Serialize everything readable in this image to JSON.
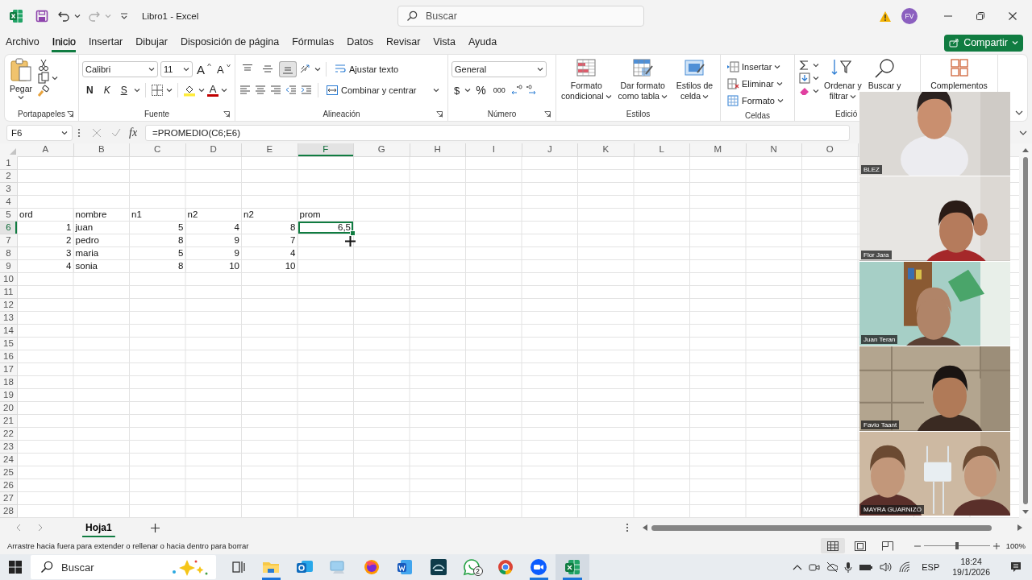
{
  "window": {
    "title": "Libro1 - Excel",
    "search_placeholder": "Buscar",
    "account_initials": "FV"
  },
  "menu_tabs": [
    {
      "label": "Archivo",
      "selected": false
    },
    {
      "label": "Inicio",
      "selected": true
    },
    {
      "label": "Insertar",
      "selected": false
    },
    {
      "label": "Dibujar",
      "selected": false
    },
    {
      "label": "Disposición de página",
      "selected": false
    },
    {
      "label": "Fórmulas",
      "selected": false
    },
    {
      "label": "Datos",
      "selected": false
    },
    {
      "label": "Revisar",
      "selected": false
    },
    {
      "label": "Vista",
      "selected": false
    },
    {
      "label": "Ayuda",
      "selected": false
    }
  ],
  "share_button": "Compartir",
  "ribbon": {
    "clipboard": {
      "paste": "Pegar",
      "label": "Portapapeles"
    },
    "font": {
      "family": "Calibri",
      "size": "11",
      "grow": "A",
      "shrink": "A",
      "bold": "N",
      "italic": "K",
      "underline": "S",
      "foreground": "A",
      "label": "Fuente"
    },
    "alignment": {
      "vertical": [
        {
          "kind": "top",
          "selected": false
        },
        {
          "kind": "middle",
          "selected": false
        },
        {
          "kind": "bottom",
          "selected": true
        }
      ],
      "wrap_text": "Ajustar texto",
      "merge": "Combinar y centrar",
      "label": "Alineación"
    },
    "number": {
      "format": "General",
      "currency": "$",
      "percent": "%",
      "thousands": "000",
      "label": "Número"
    },
    "styles": {
      "buttons": [
        {
          "kind": "conditional",
          "lines": [
            "Formato",
            "condicional"
          ]
        },
        {
          "kind": "table",
          "lines": [
            "Dar formato",
            "como tabla"
          ]
        },
        {
          "kind": "cell",
          "lines": [
            "Estilos de",
            "celda"
          ]
        }
      ],
      "label": "Estilos"
    },
    "cells": {
      "buttons": [
        {
          "kind": "insert",
          "label": "Insertar"
        },
        {
          "kind": "delete",
          "label": "Eliminar"
        },
        {
          "kind": "format",
          "label": "Formato"
        }
      ],
      "label": "Celdas"
    },
    "editing": {
      "sort": [
        "Ordenar y",
        "filtrar"
      ],
      "find": [
        "Buscar y"
      ],
      "label": "Edició"
    },
    "addins": {
      "label": "Complementos"
    }
  },
  "formula_bar": {
    "name_box": "F6",
    "function_button": "fx",
    "formula": "=PROMEDIO(C6;E6)"
  },
  "sheet": {
    "columns": [
      {
        "label": "A",
        "selected": false
      },
      {
        "label": "B",
        "selected": false
      },
      {
        "label": "C",
        "selected": false
      },
      {
        "label": "D",
        "selected": false
      },
      {
        "label": "E",
        "selected": false
      },
      {
        "label": "F",
        "selected": true
      },
      {
        "label": "G",
        "selected": false
      },
      {
        "label": "H",
        "selected": false
      },
      {
        "label": "I",
        "selected": false
      },
      {
        "label": "J",
        "selected": false
      },
      {
        "label": "K",
        "selected": false
      },
      {
        "label": "L",
        "selected": false
      },
      {
        "label": "M",
        "selected": false
      },
      {
        "label": "N",
        "selected": false
      },
      {
        "label": "O",
        "selected": false
      }
    ],
    "rows": [
      {
        "label": "1",
        "selected": false
      },
      {
        "label": "2",
        "selected": false
      },
      {
        "label": "3",
        "selected": false
      },
      {
        "label": "4",
        "selected": false
      },
      {
        "label": "5",
        "selected": false,
        "cells": [
          {
            "text": "ord",
            "kind": "text",
            "active": false
          },
          {
            "text": "nombre",
            "kind": "text",
            "active": false
          },
          {
            "text": "n1",
            "kind": "text",
            "active": false
          },
          {
            "text": "n2",
            "kind": "text",
            "active": false
          },
          {
            "text": "n2",
            "kind": "text",
            "active": false
          },
          {
            "text": "prom",
            "kind": "text",
            "active": false
          }
        ]
      },
      {
        "label": "6",
        "selected": true,
        "cells": [
          {
            "text": "1",
            "kind": "number",
            "active": false
          },
          {
            "text": "juan",
            "kind": "text",
            "active": false
          },
          {
            "text": "5",
            "kind": "number",
            "active": false
          },
          {
            "text": "4",
            "kind": "number",
            "active": false
          },
          {
            "text": "8",
            "kind": "number",
            "active": false
          },
          {
            "text": "6,5",
            "kind": "number",
            "active": true
          }
        ]
      },
      {
        "label": "7",
        "selected": false,
        "cells": [
          {
            "text": "2",
            "kind": "number",
            "active": false
          },
          {
            "text": "pedro",
            "kind": "text",
            "active": false
          },
          {
            "text": "8",
            "kind": "number",
            "active": false
          },
          {
            "text": "9",
            "kind": "number",
            "active": false
          },
          {
            "text": "7",
            "kind": "number",
            "active": false
          }
        ]
      },
      {
        "label": "8",
        "selected": false,
        "cells": [
          {
            "text": "3",
            "kind": "number",
            "active": false
          },
          {
            "text": "maria",
            "kind": "text",
            "active": false
          },
          {
            "text": "5",
            "kind": "number",
            "active": false
          },
          {
            "text": "9",
            "kind": "number",
            "active": false
          },
          {
            "text": "4",
            "kind": "number",
            "active": false
          }
        ]
      },
      {
        "label": "9",
        "selected": false,
        "cells": [
          {
            "text": "4",
            "kind": "number",
            "active": false
          },
          {
            "text": "sonia",
            "kind": "text",
            "active": false
          },
          {
            "text": "8",
            "kind": "number",
            "active": false
          },
          {
            "text": "10",
            "kind": "number",
            "active": false
          },
          {
            "text": "10",
            "kind": "number",
            "active": false
          }
        ]
      },
      {
        "label": "10",
        "selected": false
      },
      {
        "label": "11",
        "selected": false
      },
      {
        "label": "12",
        "selected": false
      },
      {
        "label": "13",
        "selected": false
      },
      {
        "label": "14",
        "selected": false
      },
      {
        "label": "15",
        "selected": false
      },
      {
        "label": "16",
        "selected": false
      },
      {
        "label": "17",
        "selected": false
      },
      {
        "label": "18",
        "selected": false
      },
      {
        "label": "19",
        "selected": false
      },
      {
        "label": "20",
        "selected": false
      },
      {
        "label": "21",
        "selected": false
      },
      {
        "label": "22",
        "selected": false
      },
      {
        "label": "23",
        "selected": false
      },
      {
        "label": "24",
        "selected": false
      },
      {
        "label": "25",
        "selected": false
      },
      {
        "label": "26",
        "selected": false
      },
      {
        "label": "27",
        "selected": false
      },
      {
        "label": "28",
        "selected": false
      }
    ]
  },
  "video_tiles": [
    {
      "kind": "picture",
      "name": "BLEZ"
    },
    {
      "kind": "picture",
      "name": "Flor Jara"
    },
    {
      "kind": "picture",
      "name": "Juan Teran"
    },
    {
      "kind": "picture",
      "name": "Favio Taant"
    },
    {
      "kind": "picture",
      "name": "MAYRA GUARNIZO"
    }
  ],
  "sheet_tabs": [
    {
      "label": "Hoja1",
      "selected": true
    }
  ],
  "status_bar": {
    "message": "Arrastre hacia fuera para extender o rellenar o hacia dentro para borrar",
    "views": [
      {
        "kind": "normal",
        "selected": true
      },
      {
        "kind": "page_layout",
        "selected": false
      },
      {
        "kind": "page_break",
        "selected": false
      }
    ],
    "zoom": {
      "level": 0.5,
      "reading": "100%"
    }
  },
  "taskbar": {
    "search_placeholder": "Buscar",
    "apps": [
      {
        "kind": "task_view",
        "running": false,
        "selected": false
      },
      {
        "kind": "folder",
        "running": true,
        "selected": false
      },
      {
        "kind": "mail",
        "running": false,
        "selected": false
      },
      {
        "kind": "monitor",
        "running": false,
        "selected": false
      },
      {
        "kind": "globe",
        "running": false,
        "selected": false
      },
      {
        "kind": "document",
        "running": false,
        "selected": false
      },
      {
        "kind": "video",
        "running": false,
        "selected": false
      },
      {
        "kind": "chat",
        "running": false,
        "selected": false,
        "badge": "2"
      },
      {
        "kind": "browser",
        "running": false,
        "selected": false
      },
      {
        "kind": "camera",
        "running": true,
        "selected": false
      },
      {
        "kind": "spreadsheet",
        "running": true,
        "selected": true
      }
    ],
    "language": "ESP",
    "time": "18:24",
    "date": "19/1/2026"
  }
}
